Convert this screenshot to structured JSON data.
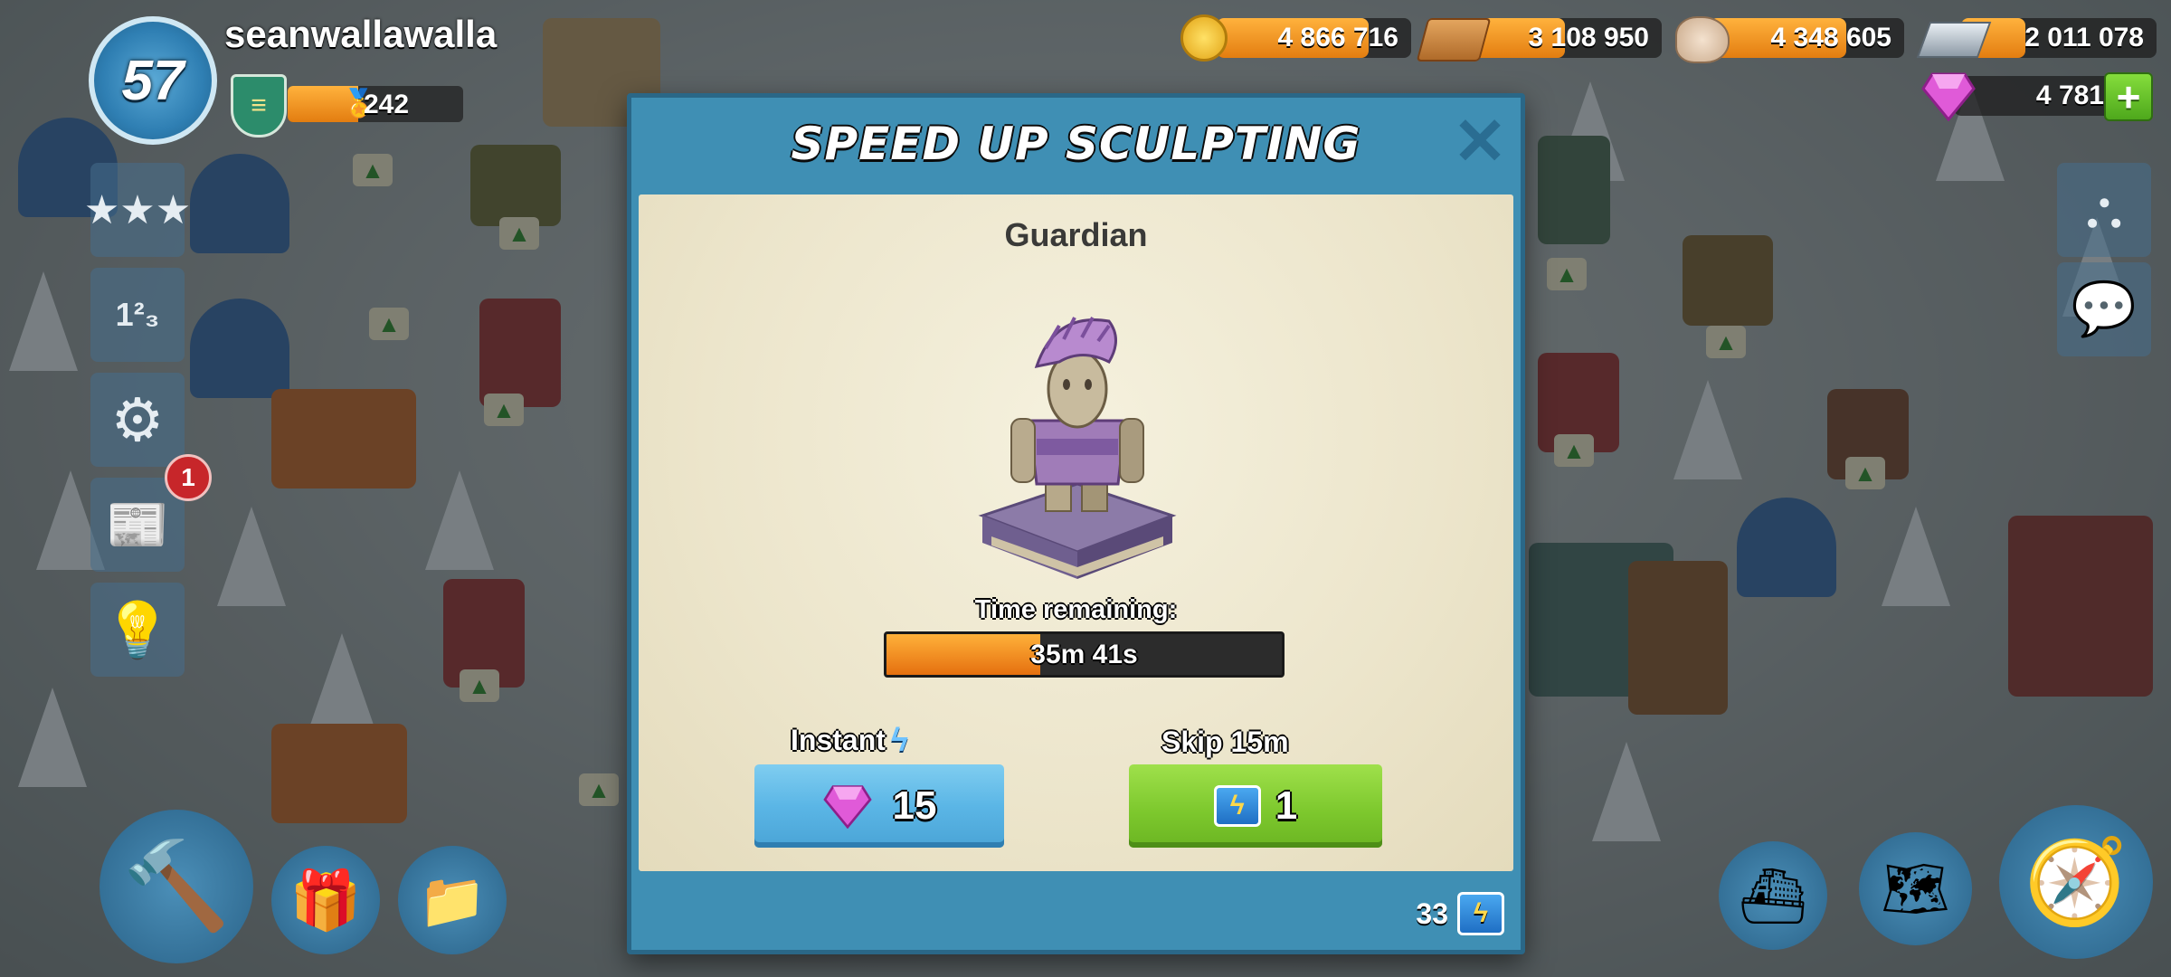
{
  "player": {
    "level": "57",
    "name": "seanwallawalla",
    "rank_points": "242"
  },
  "resources": {
    "gold": {
      "value": "4 866 716",
      "icon": "gold-coin-icon",
      "fill": 0.78
    },
    "wood": {
      "value": "3 108 950",
      "icon": "wood-planks-icon",
      "fill": 0.5
    },
    "stone": {
      "value": "4 348 605",
      "icon": "stone-icon",
      "fill": 0.7
    },
    "iron": {
      "value": "2 011 078",
      "icon": "iron-bar-icon",
      "fill": 0.33
    },
    "diamonds": {
      "value": "4 781",
      "icon": "diamond-icon"
    }
  },
  "side_menu": {
    "news_badge": "1"
  },
  "dialog": {
    "title": "SPEED UP SCULPTING",
    "item_name": "Guardian",
    "time_label": "Time remaining:",
    "time_value": "35m 41s",
    "progress": 0.39,
    "instant_label": "Instant",
    "instant_cost": "15",
    "skip_label": "Skip 15m",
    "skip_cost": "1",
    "energy_owned": "33"
  },
  "colors": {
    "dialog_blue": "#3f8fb4",
    "instant_button": "#5bb6e6",
    "skip_button": "#7ec92e",
    "progress_orange": "#ef8c1f",
    "diamond_pink": "#e05ad8"
  }
}
